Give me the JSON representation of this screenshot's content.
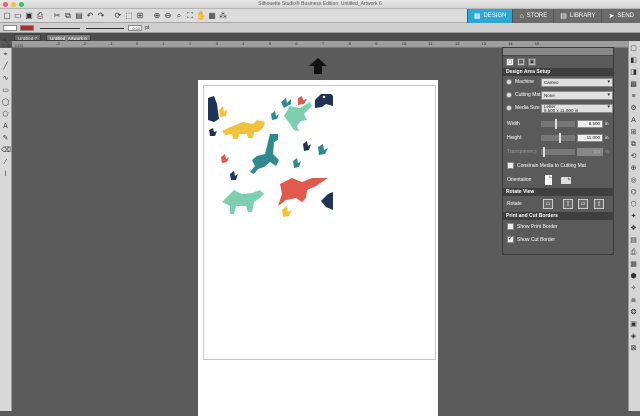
{
  "window": {
    "title": "Silhouette Studio® Business Edition: Untitled_Artwork 6"
  },
  "colors": {
    "accent": "#2aa9d6",
    "traffic_red": "#fc605c",
    "traffic_yellow": "#fdbc40",
    "traffic_green": "#34c84a",
    "cut_border": "#e8b7b7",
    "dino_navy": "#1f3456",
    "dino_mint": "#7dcfb0",
    "dino_teal": "#2f8a8e",
    "dino_yellow": "#f2c33a",
    "dino_coral": "#e05a4e"
  },
  "nav_tabs": [
    {
      "label": "DESIGN",
      "icon": "design-icon"
    },
    {
      "label": "STORE",
      "icon": "store-icon"
    },
    {
      "label": "LIBRARY",
      "icon": "library-icon"
    },
    {
      "label": "SEND",
      "icon": "send-icon"
    }
  ],
  "toolbar_icons": [
    "new-document-icon",
    "open-icon",
    "save-icon",
    "print-icon",
    "cut-icon",
    "copy-icon",
    "paste-icon",
    "undo-icon",
    "redo-icon",
    "rotate-icon",
    "select-all-icon",
    "group-icon",
    "zoom-in-icon",
    "zoom-out-icon",
    "zoom-drag-icon",
    "fit-page-icon",
    "pan-icon",
    "grid-icon",
    "replicate-icon"
  ],
  "propbar": {
    "line_width_value": "0.00",
    "line_width_unit": "pt"
  },
  "document_tabs": [
    {
      "label": "Untitled-7",
      "active": false
    },
    {
      "label": "Untitled_Artwork 6",
      "active": true
    }
  ],
  "ruler_top_ticks": [
    "-3",
    "-2",
    "-1",
    "0",
    "1",
    "2",
    "3",
    "4",
    "5",
    "6",
    "7",
    "8",
    "9",
    "10",
    "11",
    "12",
    "13",
    "14",
    "15"
  ],
  "ruler_left_label": "13.385 , 2.221",
  "panel": {
    "title": "Design Area Setup",
    "machine_label": "Machine",
    "machine_value": "Cameo",
    "cutting_mat_label": "Cutting Mat",
    "cutting_mat_value": "None",
    "media_size_label": "Media Size",
    "media_size_value": "Letter",
    "media_size_dims": "8.500 x 11.000 in",
    "width_label": "Width",
    "width_value": "8.500",
    "width_unit": "in",
    "height_label": "Height",
    "height_value": "11.000",
    "height_unit": "in",
    "transparency_label": "Transparency",
    "transparency_value": "0.0",
    "transparency_unit": "%",
    "constrain_label": "Constrain Media to Cutting Mat",
    "orientation_label": "Orientation",
    "rotate_view_header": "Rotate View",
    "rotate_label": "Rotate",
    "print_cut_header": "Print and Cut Borders",
    "show_print_border": "Show Print Border",
    "show_print_border_checked": false,
    "show_cut_border": "Show Cut Border",
    "show_cut_border_checked": true
  }
}
